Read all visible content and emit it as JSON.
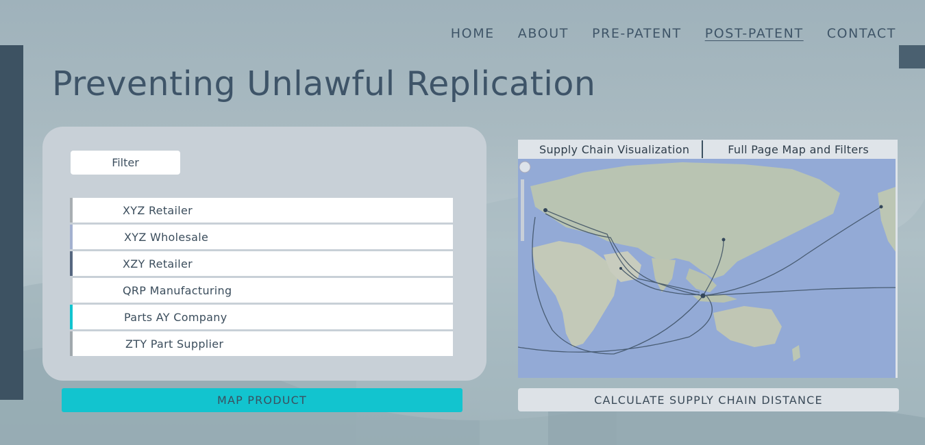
{
  "nav": {
    "items": [
      {
        "label": "HOME",
        "active": false
      },
      {
        "label": "ABOUT",
        "active": false
      },
      {
        "label": "PRE-PATENT",
        "active": false
      },
      {
        "label": "POST-PATENT",
        "active": true
      },
      {
        "label": "CONTACT",
        "active": false
      }
    ]
  },
  "page": {
    "title": "Preventing Unlawful Replication"
  },
  "filter": {
    "label": "Filter"
  },
  "suppliers": [
    {
      "name": "XYZ Retailer",
      "accent": "#a8aeb2"
    },
    {
      "name": "XYZ Wholesale",
      "accent": "#a3b1cf"
    },
    {
      "name": "XZY Retailer",
      "accent": "#566780"
    },
    {
      "name": "QRP Manufacturing",
      "accent": "#c6cdd3"
    },
    {
      "name": "Parts AY Company",
      "accent": "#12c4cf"
    },
    {
      "name": "ZTY Part Supplier",
      "accent": "#a0a8ad"
    }
  ],
  "buttons": {
    "map_product": "MAP PRODUCT",
    "calculate": "CALCULATE SUPPLY CHAIN DISTANCE"
  },
  "map_panel": {
    "tab_visualization": "Supply Chain Visualization",
    "tab_fullpage": "Full Page Map and Filters"
  },
  "colors": {
    "accent_teal": "#12c4cf",
    "dark_slate": "#3d5262",
    "panel": "#c8d0d7"
  }
}
